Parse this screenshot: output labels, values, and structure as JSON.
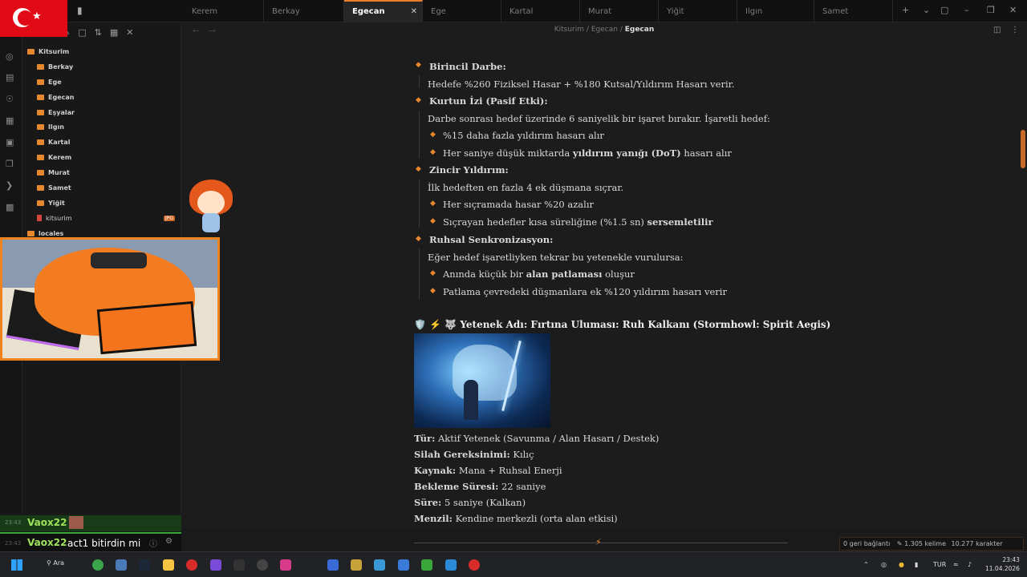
{
  "tabs": [
    {
      "label": "Kerem",
      "active": false
    },
    {
      "label": "Berkay",
      "active": false
    },
    {
      "label": "Egecan",
      "active": true
    },
    {
      "label": "Ege",
      "active": false
    },
    {
      "label": "Kartal",
      "active": false
    },
    {
      "label": "Murat",
      "active": false
    },
    {
      "label": "Yiğit",
      "active": false
    },
    {
      "label": "Ilgın",
      "active": false
    },
    {
      "label": "Samet",
      "active": false
    }
  ],
  "tab_close_glyph": "✕",
  "window_controls": {
    "new_tab": "+",
    "dropdown": "⌄",
    "layout": "▢",
    "minimize": "–",
    "maximize": "❐",
    "close": "✕"
  },
  "breadcrumb": {
    "root": "Kitsurim",
    "sep1": "/",
    "mid": "Egecan",
    "sep2": "/",
    "current": "Egecan"
  },
  "sidebar": {
    "root": "Kitsurim",
    "folders": [
      "Berkay",
      "Ege",
      "Egecan",
      "Eşyalar",
      "Ilgın",
      "Kartal",
      "Kerem",
      "Murat",
      "Samet",
      "Yiğit"
    ],
    "file": {
      "name": "kitsurim",
      "badge": "JPG"
    },
    "partial": "locales"
  },
  "content": {
    "s1_title": "Birincil Darbe:",
    "s1_text": "Hedefe %260 Fiziksel Hasar + %180 Kutsal/Yıldırım Hasarı verir.",
    "s2_title": "Kurtun İzi (Pasif Etki):",
    "s2_text": "Darbe sonrası hedef üzerinde 6 saniyelik bir işaret bırakır. İşaretli hedef:",
    "s2_b1": "%15 daha fazla yıldırım hasarı alır",
    "s2_b2_pre": "Her saniye düşük miktarda ",
    "s2_b2_bold": "yıldırım yanığı (DoT)",
    "s2_b2_post": " hasarı alır",
    "s3_title": "Zincir Yıldırım:",
    "s3_text": "İlk hedeften en fazla 4 ek düşmana sıçrar.",
    "s3_b1": "Her sıçramada hasar %20 azalır",
    "s3_b2_pre": "Sıçrayan hedefler kısa süreliğine (%1.5 sn) ",
    "s3_b2_bold": "sersemletilir",
    "s4_title": "Ruhsal Senkronizasyon:",
    "s4_text": "Eğer hedef işaretliyken tekrar bu yetenekle vurulursa:",
    "s4_b1_pre": "Anında küçük bir ",
    "s4_b1_bold": "alan patlaması",
    "s4_b1_post": " oluşur",
    "s4_b2": "Patlama çevredeki düşmanlara ek %120 yıldırım hasarı verir",
    "ability_emojis": "🛡️ ⚡ 🐺",
    "ability_title": "Yetenek Adı: Fırtına Uluması: Ruh Kalkanı (Stormhowl: Spirit Aegis)",
    "props": [
      {
        "key": "Tür:",
        "val": "Aktif Yetenek (Savunma / Alan Hasarı / Destek)"
      },
      {
        "key": "Silah Gereksinimi:",
        "val": "Kılıç"
      },
      {
        "key": "Kaynak:",
        "val": "Mana + Ruhsal Enerji"
      },
      {
        "key": "Bekleme Süresi:",
        "val": "22 saniye"
      },
      {
        "key": "Süre:",
        "val": "5 saniye (Kalkan)"
      },
      {
        "key": "Menzil:",
        "val": "Kendine merkezli (orta alan etkisi)"
      }
    ]
  },
  "status": {
    "backlinks": "0 geri bağlantı",
    "words": "1.305 kelime",
    "chars": "10.277 karakter"
  },
  "chat": [
    {
      "time": "23:43",
      "user": "Vaox22",
      "message": ""
    },
    {
      "time": "23:43",
      "user": "Vaox22",
      "message": "act1 bitirdin mi"
    }
  ],
  "taskbar": {
    "search": "Ara",
    "lang": "TUR",
    "time": "23:43",
    "date": "11.04.2026"
  },
  "colors": {
    "accent": "#e8882e",
    "flag_red": "#e30a17",
    "chat_name": "#9fe35b"
  }
}
